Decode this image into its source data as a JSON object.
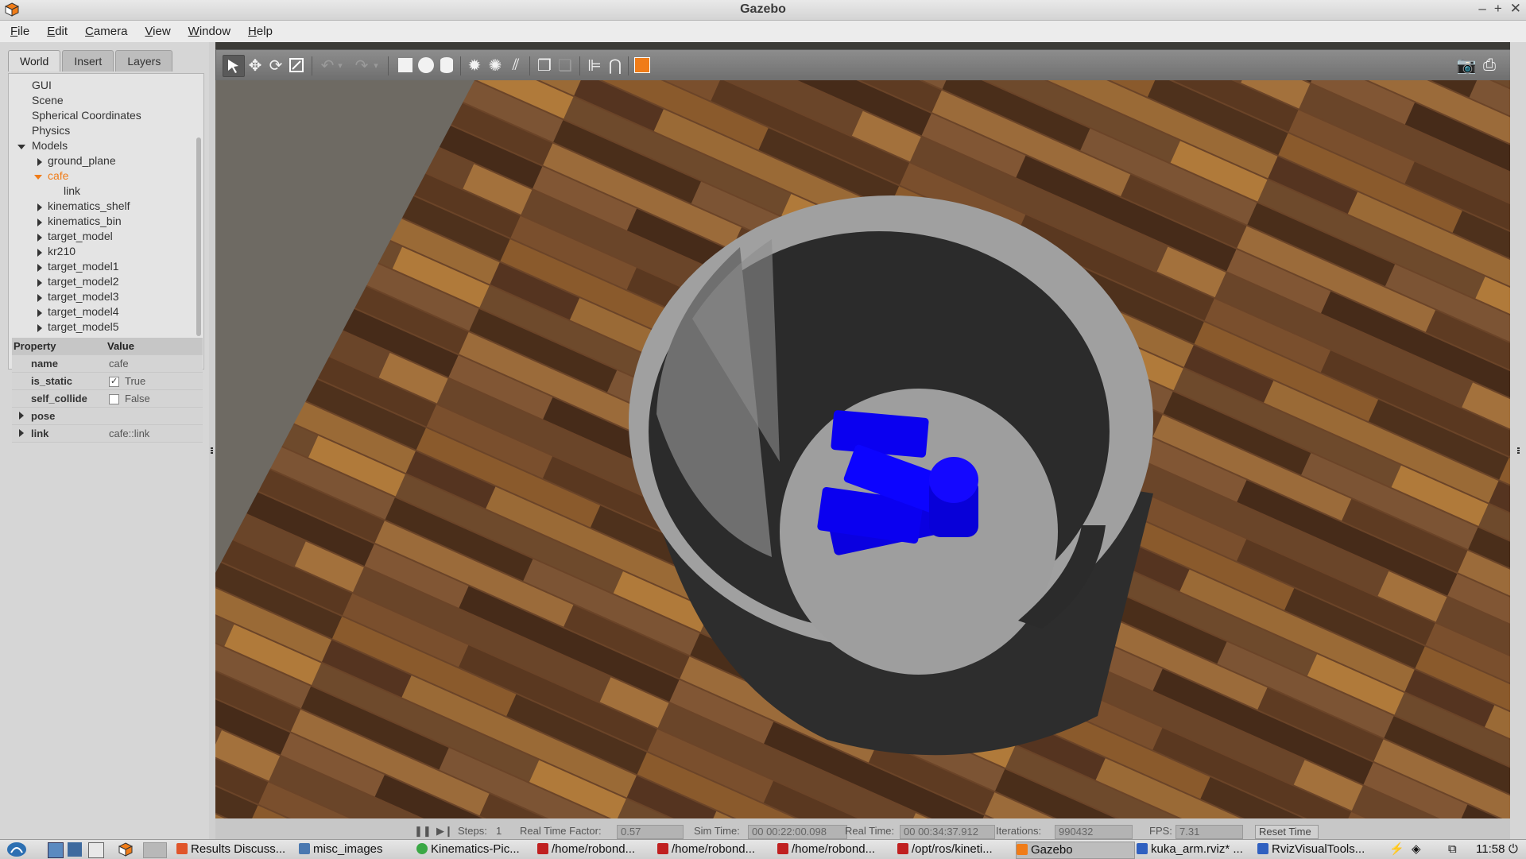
{
  "window": {
    "title": "Gazebo",
    "controls": [
      "–",
      "+",
      "✕"
    ]
  },
  "menu": [
    {
      "label": "File",
      "underline": "F",
      "rest": "ile"
    },
    {
      "label": "Edit",
      "underline": "E",
      "rest": "dit"
    },
    {
      "label": "Camera",
      "underline": "C",
      "rest": "amera"
    },
    {
      "label": "View",
      "underline": "V",
      "rest": "iew"
    },
    {
      "label": "Window",
      "underline": "W",
      "rest": "indow"
    },
    {
      "label": "Help",
      "underline": "H",
      "rest": "elp"
    }
  ],
  "left_tabs": [
    "World",
    "Insert",
    "Layers"
  ],
  "tree": [
    "GUI",
    "Scene",
    "Spherical Coordinates",
    "Physics",
    "Models",
    "ground_plane",
    "cafe",
    "link",
    "kinematics_shelf",
    "kinematics_bin",
    "target_model",
    "kr210",
    "target_model1",
    "target_model2",
    "target_model3",
    "target_model4",
    "target_model5"
  ],
  "properties": {
    "header": {
      "property": "Property",
      "value": "Value"
    },
    "name": {
      "key": "name",
      "value": "cafe"
    },
    "is_static": {
      "key": "is_static",
      "value": "True"
    },
    "self_collide": {
      "key": "self_collide",
      "value": "False"
    },
    "pose": {
      "key": "pose"
    },
    "link": {
      "key": "link",
      "value": "cafe::link"
    }
  },
  "status": {
    "steps_label": "Steps:",
    "steps": "1",
    "rtf_label": "Real Time Factor:",
    "rtf": "0.57",
    "sim_label": "Sim Time:",
    "sim": "00 00:22:00.098",
    "real_label": "Real Time:",
    "real": "00 00:34:37.912",
    "iter_label": "Iterations:",
    "iter": "990432",
    "fps_label": "FPS:",
    "fps": "7.31",
    "reset": "Reset Time"
  },
  "taskbar": {
    "items": [
      "Results Discuss...",
      "misc_images",
      "Kinematics-Pic...",
      "/home/robond...",
      "/home/robond...",
      "/home/robond...",
      "/opt/ros/kineti...",
      "Gazebo",
      "kuka_arm.rviz* ...",
      "RvizVisualTools..."
    ],
    "clock": "11:58"
  },
  "colors": {
    "accent": "#f07c18",
    "blue": "#0a00f0",
    "bin_rim": "#9d9d9d",
    "bin_inner": "#2a2a2a"
  }
}
